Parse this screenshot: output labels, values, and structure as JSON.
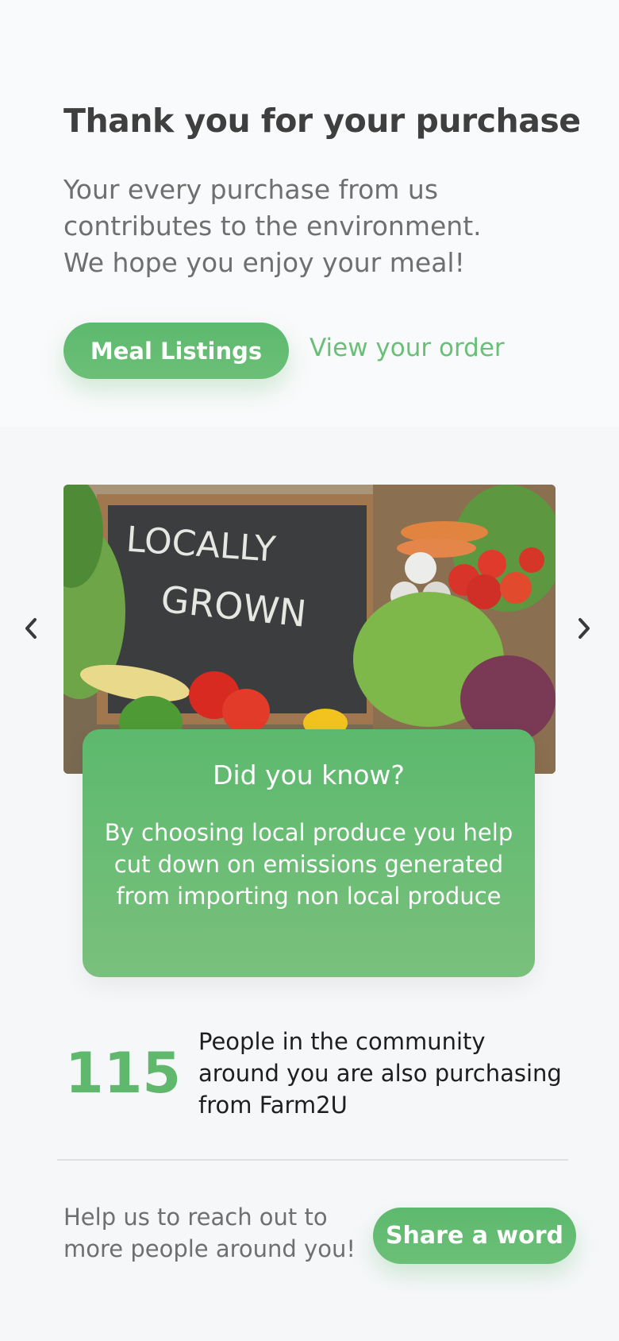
{
  "header": {
    "title": "Thank you for your purchase",
    "subtitle": "Your every purchase from us contributes to the environment. We hope you enjoy your meal!"
  },
  "actions": {
    "meal_listings_label": "Meal Listings",
    "view_order_label": "View your order"
  },
  "carousel": {
    "prev_icon": "chevron-left-icon",
    "next_icon": "chevron-right-icon",
    "image_sign_text": "LOCALLY GROWN",
    "card_title": "Did you know?",
    "card_text": "By choosing local produce you help cut down on emissions generated from importing non local produce"
  },
  "stats": {
    "count": "115",
    "text": "People in the community around you are also purchasing from Farm2U"
  },
  "share": {
    "help_text": "Help us to reach out to more people around you!",
    "button_label": "Share a word"
  },
  "colors": {
    "accent": "#5cb96d",
    "accent_light": "#79c07c",
    "title": "#3f3f3f",
    "muted": "#6f6f6f",
    "background": "#f6f7f9"
  }
}
